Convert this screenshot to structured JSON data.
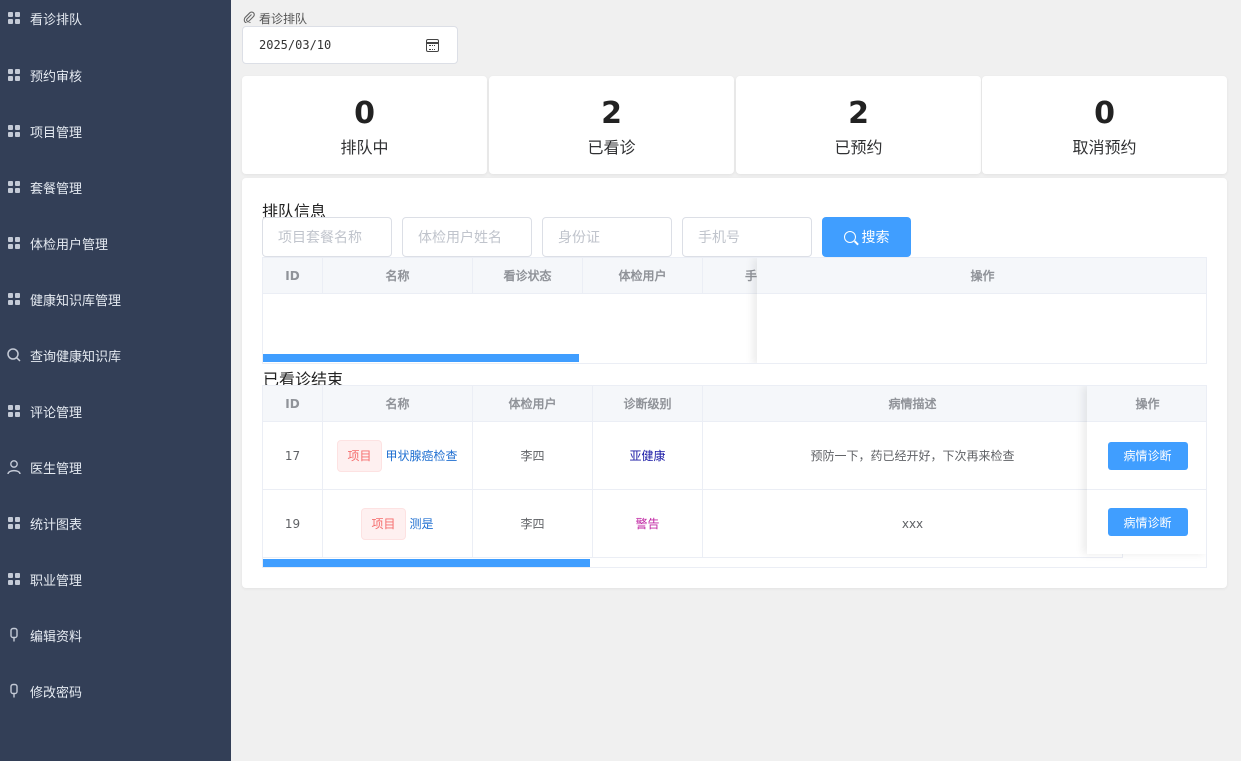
{
  "sidebar": {
    "items": [
      {
        "label": "看诊排队",
        "icon": "grid-icon"
      },
      {
        "label": "预约审核",
        "icon": "grid-icon"
      },
      {
        "label": "项目管理",
        "icon": "grid-icon"
      },
      {
        "label": "套餐管理",
        "icon": "grid-icon"
      },
      {
        "label": "体检用户管理",
        "icon": "grid-icon"
      },
      {
        "label": "健康知识库管理",
        "icon": "grid-icon"
      },
      {
        "label": "查询健康知识库",
        "icon": "search-icon"
      },
      {
        "label": "评论管理",
        "icon": "grid-icon"
      },
      {
        "label": "医生管理",
        "icon": "user-icon"
      },
      {
        "label": "统计图表",
        "icon": "grid-icon"
      },
      {
        "label": "职业管理",
        "icon": "grid-icon"
      },
      {
        "label": "编辑资料",
        "icon": "mic-icon"
      },
      {
        "label": "修改密码",
        "icon": "mic-icon"
      }
    ]
  },
  "header": {
    "breadcrumb": "看诊排队",
    "date_value": "2025/03/10"
  },
  "stats": [
    {
      "value": "0",
      "label": "排队中"
    },
    {
      "value": "2",
      "label": "已看诊"
    },
    {
      "value": "2",
      "label": "已预约"
    },
    {
      "value": "0",
      "label": "取消预约"
    }
  ],
  "queue": {
    "title": "排队信息",
    "filters": {
      "package_placeholder": "项目套餐名称",
      "user_placeholder": "体检用户姓名",
      "idcard_placeholder": "身份证",
      "phone_placeholder": "手机号",
      "search_label": "搜索"
    },
    "columns": [
      "ID",
      "名称",
      "看诊状态",
      "体检用户",
      "手",
      "操作"
    ]
  },
  "finished": {
    "title": "已看诊结束",
    "columns": [
      "ID",
      "名称",
      "体检用户",
      "诊断级别",
      "病情描述",
      "操作"
    ],
    "rows": [
      {
        "id": "17",
        "tag": "项目",
        "name": "甲状腺癌检查",
        "user": "李四",
        "level": "亚健康",
        "level_color": "#1a1aa6",
        "desc": "预防一下，药已经开好，下次再来检查",
        "action": "病情诊断"
      },
      {
        "id": "19",
        "tag": "项目",
        "name": "测是",
        "user": "李四",
        "level": "警告",
        "level_color": "#c026a3",
        "desc": "xxx",
        "action": "病情诊断"
      }
    ]
  },
  "colors": {
    "sidebar_bg": "#333f57",
    "primary": "#409eff",
    "tag_text": "#f56c6c"
  }
}
